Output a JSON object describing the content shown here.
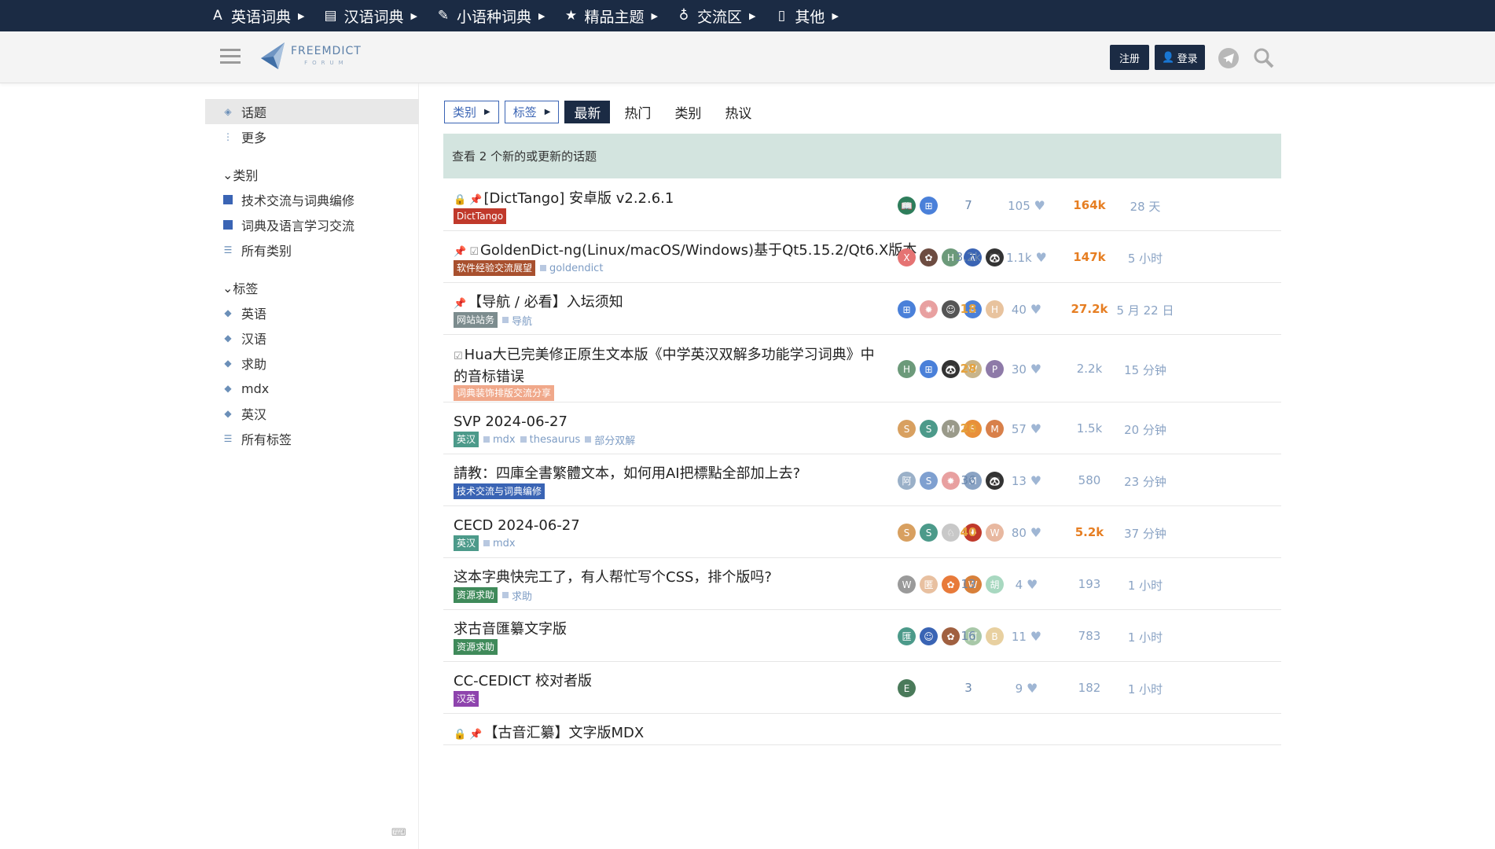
{
  "topnav": [
    {
      "icon": "letter-a-icon",
      "glyph": "A",
      "label": "英语词典"
    },
    {
      "icon": "book-icon",
      "glyph": "▤",
      "label": "汉语词典"
    },
    {
      "icon": "magic-wand-icon",
      "glyph": "✎",
      "label": "小语种词典"
    },
    {
      "icon": "star-icon",
      "glyph": "★",
      "label": "精品主题"
    },
    {
      "icon": "lightbulb-icon",
      "glyph": "♁",
      "label": "交流区"
    },
    {
      "icon": "file-icon",
      "glyph": "▯",
      "label": "其他"
    }
  ],
  "header": {
    "logo_line1": "FREEMDICT",
    "logo_line2": "FORUM",
    "register_label": "注册",
    "login_label": "登录"
  },
  "sidebar": {
    "topics_label": "话题",
    "more_label": "更多",
    "categories_head": "类别",
    "categories": [
      "技术交流与词典编修",
      "词典及语言学习交流"
    ],
    "all_categories": "所有类别",
    "tags_head": "标签",
    "tags": [
      "英语",
      "汉语",
      "求助",
      "mdx",
      "英汉"
    ],
    "all_tags": "所有标签"
  },
  "nav": {
    "categories_dd": "类别",
    "tags_dd": "标签",
    "latest": "最新",
    "hot": "热门",
    "categories": "类别",
    "top": "热议"
  },
  "banner_text": "查看 2 个新的或更新的话题",
  "colors": {
    "navy": "#1b2b44",
    "accent_blue": "#3a64b4",
    "hot_orange": "#e67e22",
    "banner_green": "#d3e4df"
  },
  "topics": [
    {
      "prefix": "🔒 📌",
      "title": "[DictTango] 安卓版 v2.2.6.1",
      "title2": "",
      "badge": "DictTango",
      "badge_color": "#c0392b",
      "tags": [],
      "avatars": [
        {
          "t": "📖",
          "c": "#2e7d5b"
        },
        {
          "t": "⊞",
          "c": "#4a80d9"
        }
      ],
      "replies": "7",
      "likes": "105",
      "views": "164k",
      "views_hot": true,
      "replies_hot": false,
      "activity": "28 天"
    },
    {
      "prefix": "📌 ☑",
      "title": "GoldenDict-ng(Linux/macOS/Windows)基于Qt5.15.2/Qt6.X版本",
      "title2": "",
      "badge": "软件经验交流展望",
      "badge_color": "#a8502e",
      "tags": [
        "goldendict"
      ],
      "avatars": [
        {
          "t": "X",
          "c": "#e57373"
        },
        {
          "t": "✿",
          "c": "#6d4c41"
        },
        {
          "t": "H",
          "c": "#6c9a7a"
        },
        {
          "t": "⊼",
          "c": "#3a64b4"
        },
        {
          "t": "🐼",
          "c": "#333"
        }
      ],
      "replies": "3.2k",
      "likes": "1.1k",
      "views": "147k",
      "views_hot": true,
      "replies_hot": false,
      "activity": "5 小时"
    },
    {
      "prefix": "📌",
      "title": "【导航 / 必看】入坛须知",
      "title2": "",
      "badge": "网站站务",
      "badge_color": "#7c8c8e",
      "tags": [
        "导航"
      ],
      "avatars": [
        {
          "t": "⊞",
          "c": "#4a80d9"
        },
        {
          "t": "✹",
          "c": "#e8a0a0"
        },
        {
          "t": "☺",
          "c": "#555"
        },
        {
          "t": "A",
          "c": "#4a80d9"
        },
        {
          "t": "H",
          "c": "#e8c39e"
        }
      ],
      "replies": "18",
      "likes": "40",
      "views": "27.2k",
      "views_hot": true,
      "replies_hot": true,
      "activity": "5 月 22 日"
    },
    {
      "prefix": "☑",
      "title": "Hua大已完美修正原生文本版《中学英汉双解多功能学习词典》中",
      "title2": "的音标错误",
      "badge": "词典装饰排版交流分享",
      "badge_color": "#f0a88a",
      "tags": [],
      "avatars": [
        {
          "t": "H",
          "c": "#6c9a7a"
        },
        {
          "t": "⊞",
          "c": "#4a80d9"
        },
        {
          "t": "🐼",
          "c": "#333"
        },
        {
          "t": "W",
          "c": "#c8b48a"
        },
        {
          "t": "P",
          "c": "#8e7aa8"
        }
      ],
      "replies": "28",
      "likes": "30",
      "views": "2.2k",
      "views_hot": false,
      "replies_hot": true,
      "activity": "15 分钟"
    },
    {
      "prefix": "",
      "title": "SVP 2024-06-27",
      "title2": "",
      "badge": "英汉",
      "badge_color": "#4c9a8a",
      "tags": [
        "mdx",
        "thesaurus",
        "部分双解"
      ],
      "avatars": [
        {
          "t": "S",
          "c": "#d8a060"
        },
        {
          "t": "S",
          "c": "#4c9a8a"
        },
        {
          "t": "M",
          "c": "#9a9a8a"
        },
        {
          "t": "S",
          "c": "#e8903a"
        },
        {
          "t": "M",
          "c": "#d8804a"
        }
      ],
      "replies": "20",
      "likes": "57",
      "views": "1.5k",
      "views_hot": false,
      "replies_hot": true,
      "activity": "20 分钟"
    },
    {
      "prefix": "",
      "title": "請教：四庫全書繁體文本，如何用AI把標點全部加上去?",
      "title2": "",
      "badge": "技术交流与词典编修",
      "badge_color": "#3a64b4",
      "tags": [],
      "avatars": [
        {
          "t": "阿",
          "c": "#9ab0c8"
        },
        {
          "t": "S",
          "c": "#7fa0d0"
        },
        {
          "t": "✹",
          "c": "#e8a0a0"
        },
        {
          "t": "M",
          "c": "#8aa3c4"
        },
        {
          "t": "🐼",
          "c": "#333"
        }
      ],
      "replies": "36",
      "likes": "13",
      "views": "580",
      "views_hot": false,
      "replies_hot": false,
      "activity": "23 分钟"
    },
    {
      "prefix": "",
      "title": "CECD 2024-06-27",
      "title2": "",
      "badge": "英汉",
      "badge_color": "#4c9a8a",
      "tags": [
        "mdx"
      ],
      "avatars": [
        {
          "t": "S",
          "c": "#d8a060"
        },
        {
          "t": "S",
          "c": "#4c9a8a"
        },
        {
          "t": "♘",
          "c": "#c8c8c8"
        },
        {
          "t": "✚",
          "c": "#c0392b"
        },
        {
          "t": "W",
          "c": "#e8b8a0"
        }
      ],
      "replies": "40",
      "likes": "80",
      "views": "5.2k",
      "views_hot": true,
      "replies_hot": true,
      "activity": "37 分钟"
    },
    {
      "prefix": "",
      "title": "这本字典快完工了，有人帮忙写个CSS，排个版吗?",
      "title2": "",
      "badge": "资源求助",
      "badge_color": "#3f8a5a",
      "tags": [
        "求助"
      ],
      "avatars": [
        {
          "t": "W",
          "c": "#9a9a9a"
        },
        {
          "t": "匿",
          "c": "#e8c0a0"
        },
        {
          "t": "✿",
          "c": "#e87a3a"
        },
        {
          "t": "W",
          "c": "#d8803a"
        },
        {
          "t": "胡",
          "c": "#a8d8c0"
        }
      ],
      "replies": "13",
      "likes": "4",
      "views": "193",
      "views_hot": false,
      "replies_hot": false,
      "activity": "1 小时"
    },
    {
      "prefix": "",
      "title": "求古音匯纂文字版",
      "title2": "",
      "badge": "资源求助",
      "badge_color": "#3f8a5a",
      "tags": [],
      "avatars": [
        {
          "t": "匯",
          "c": "#4c9a8a"
        },
        {
          "t": "☺",
          "c": "#3a64b4"
        },
        {
          "t": "✿",
          "c": "#a06040"
        },
        {
          "t": "阿",
          "c": "#a8c8a8"
        },
        {
          "t": "B",
          "c": "#e8d0a0"
        }
      ],
      "replies": "16",
      "likes": "11",
      "views": "783",
      "views_hot": false,
      "replies_hot": false,
      "activity": "1 小时"
    },
    {
      "prefix": "",
      "title": "CC-CEDICT 校对者版",
      "title2": "",
      "badge": "汉英",
      "badge_color": "#8e44ad",
      "tags": [],
      "avatars": [
        {
          "t": "E",
          "c": "#4a7a5a"
        }
      ],
      "replies": "3",
      "likes": "9",
      "views": "182",
      "views_hot": false,
      "replies_hot": false,
      "activity": "1 小时"
    },
    {
      "prefix": "🔒 📌",
      "title": "【古音汇纂】文字版MDX",
      "title2": "",
      "badge": "",
      "badge_color": "",
      "tags": [],
      "avatars": [],
      "replies": "",
      "likes": "",
      "views": "",
      "views_hot": false,
      "replies_hot": false,
      "activity": ""
    }
  ]
}
